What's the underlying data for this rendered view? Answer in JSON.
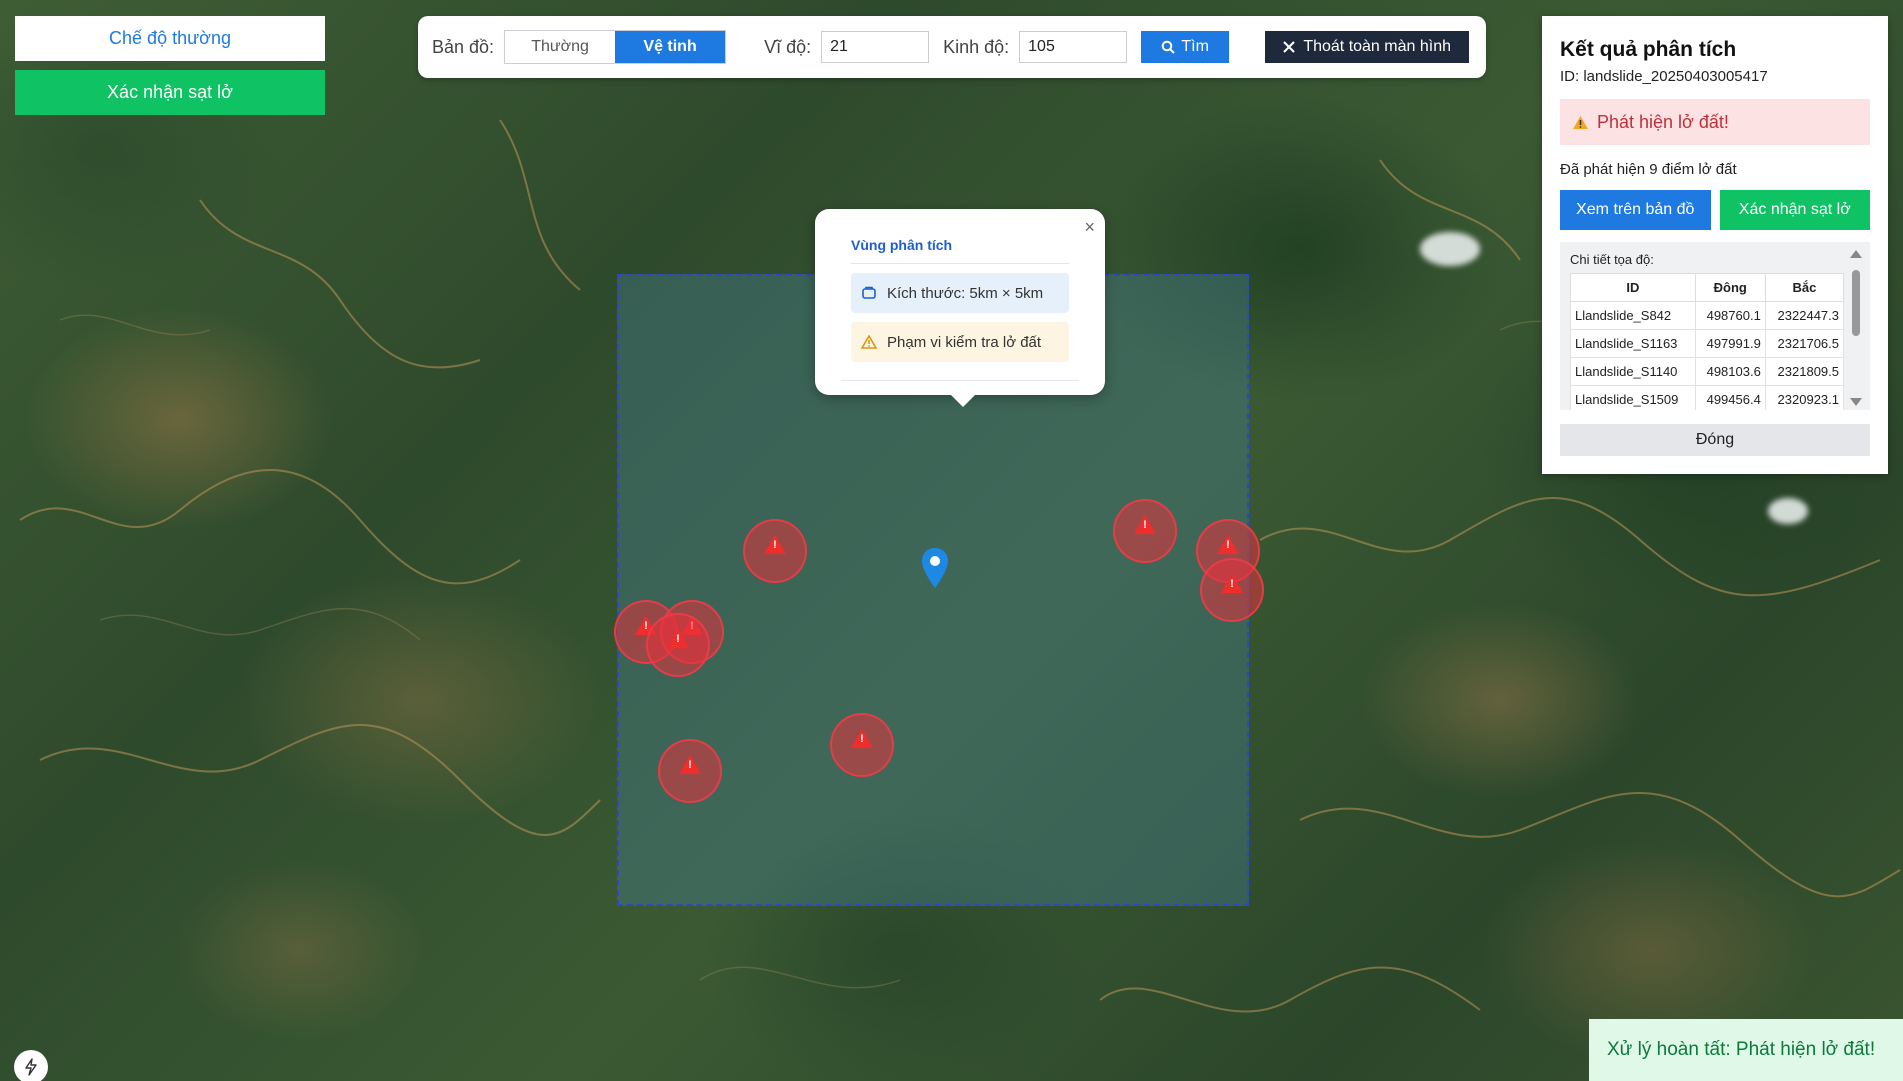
{
  "mode_buttons": {
    "normal_label": "Chế độ thường",
    "confirm_label": "Xác nhận sạt lở"
  },
  "toolbar": {
    "map_label": "Bản đồ:",
    "map_types": [
      "Thường",
      "Vệ tinh"
    ],
    "map_type_selected": "Vệ tinh",
    "lat_label": "Vĩ độ:",
    "lat_value": "21",
    "lon_label": "Kinh độ:",
    "lon_value": "105",
    "search_label": "Tìm",
    "exit_fullscreen_label": "Thoát toàn màn hình"
  },
  "popup": {
    "title": "Vùng phân tích",
    "close_glyph": "×",
    "size_text": "Kích thước: 5km × 5km",
    "scope_text": "Phạm vi kiểm tra lở đất"
  },
  "result_panel": {
    "title": "Kết quả phân tích",
    "id_text": "ID: landslide_20250403005417",
    "alert_text": "Phát hiện lở đất!",
    "found_text": "Đã phát hiện 9 điểm lở đất",
    "view_map_label": "Xem trên bản đồ",
    "confirm_label": "Xác nhận sạt lở",
    "detail_label": "Chi tiết tọa độ:",
    "table": {
      "columns": [
        "ID",
        "Đông",
        "Bắc"
      ],
      "rows": [
        [
          "Llandslide_S842",
          "498760.1",
          "2322447.3"
        ],
        [
          "Llandslide_S1163",
          "497991.9",
          "2321706.5"
        ],
        [
          "Llandslide_S1140",
          "498103.6",
          "2321809.5"
        ],
        [
          "Llandslide_S1509",
          "499456.4",
          "2320923.1"
        ]
      ]
    },
    "close_label": "Đóng"
  },
  "map": {
    "landslide_marker_count": 9,
    "colors": {
      "area_border": "#2a49c9",
      "marker": "#f02d2d",
      "pin": "#1e88e5"
    }
  },
  "toast": {
    "text": "Xử lý hoàn tất: Phát hiện lở đất!"
  },
  "colors": {
    "primary": "#1e7ae0",
    "success": "#0fc264",
    "dark": "#1e293b",
    "alert_bg": "#fde2e4"
  }
}
